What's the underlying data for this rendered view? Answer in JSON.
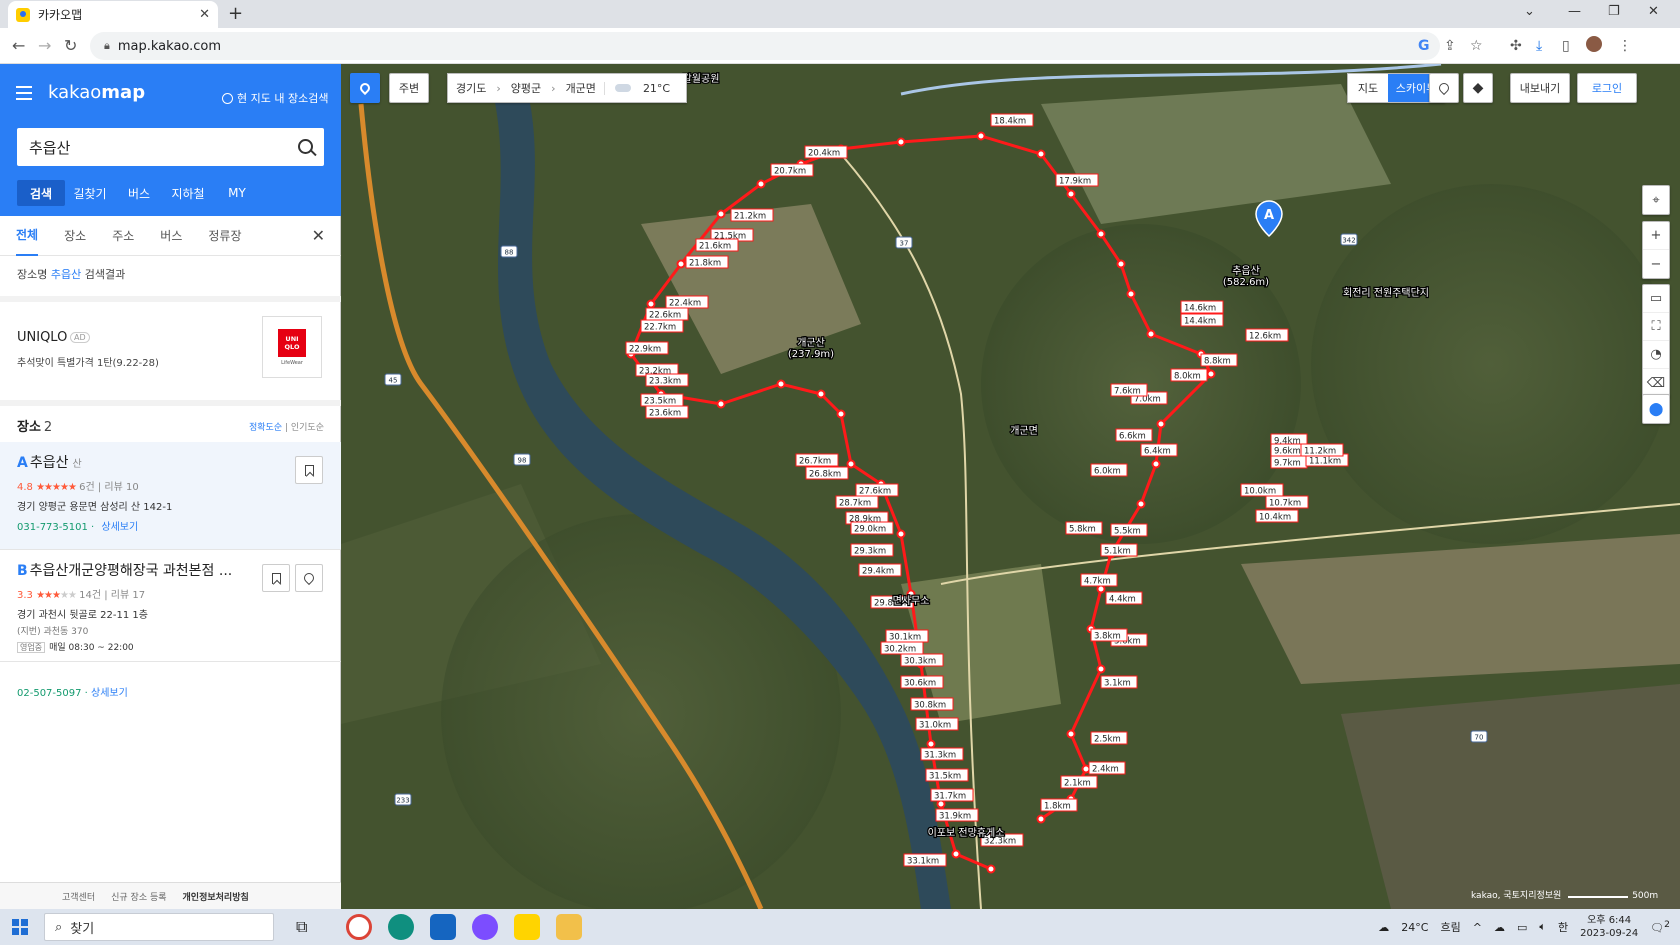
{
  "browser": {
    "tab_title": "카카오맵",
    "url": "map.kakao.com",
    "new_tab": "+",
    "close_tab": "✕"
  },
  "sidebar": {
    "brand_light": "kakao",
    "brand_bold": "map",
    "current_map_search": "현 지도 내 장소검색",
    "search_value": "추읍산",
    "main_tabs": [
      {
        "label": "검색",
        "active": true
      },
      {
        "label": "길찾기"
      },
      {
        "label": "버스"
      },
      {
        "label": "지하철"
      },
      {
        "label": "MY"
      }
    ],
    "sub_tabs": [
      {
        "label": "전체",
        "active": true
      },
      {
        "label": "장소"
      },
      {
        "label": "주소"
      },
      {
        "label": "버스"
      },
      {
        "label": "정류장"
      }
    ],
    "result_caption_prefix": "장소명",
    "result_caption_keyword": "추읍산",
    "result_caption_suffix": "검색결과",
    "ad": {
      "brand": "UNIQLO",
      "badge": "AD",
      "description": "추석맞이 특별가격 1탄(9.22-28)",
      "logo_text": "UNI QLO",
      "logo_sub": "LifeWear"
    },
    "places_label": "장소",
    "places_count": "2",
    "sort_accuracy": "정확도순",
    "sort_popularity": "인기도순",
    "places": [
      {
        "letter": "A",
        "name": "추읍산",
        "category": "산",
        "score": "4.8",
        "reviews_count": "6건",
        "reviews": "리뷰 10",
        "address": "경기 양평군 용문면 삼성리 산 142-1",
        "phone": "031-773-5101",
        "detail_link": "상세보기"
      },
      {
        "letter": "B",
        "name_highlight": "추읍산",
        "name_rest": "개군양평해장국 과천본점 ...",
        "score": "3.3",
        "reviews_count": "14건",
        "reviews": "리뷰 17",
        "address": "경기 과천시 뒷골로 22-11 1층",
        "lot_address": "(지번) 과천동 370",
        "hours_tag": "영업중",
        "hours": "매일 08:30 ~ 22:00",
        "phone": "02-507-5097",
        "detail_link": "상세보기"
      }
    ],
    "footer": [
      "고객센터",
      "신규 장소 등록",
      "개인정보처리방침"
    ]
  },
  "map": {
    "nearby_button": "주변",
    "breadcrumb": [
      "경기도",
      "양평군",
      "개군면"
    ],
    "temperature": "21°C",
    "map_type_normal": "지도",
    "map_type_skyview": "스카이뷰",
    "export_button": "내보내기",
    "login_button": "로그인",
    "scale_text": "kakao, 국토지리정보원",
    "scale_value": "500m",
    "place_labels": [
      {
        "name": "갈월공원"
      },
      {
        "name": "개군산",
        "sub": "(237.9m)"
      },
      {
        "name": "추읍산",
        "sub": "(582.6m)"
      },
      {
        "name": "개군면"
      },
      {
        "name": "회전리 전원주택단지"
      },
      {
        "name": "면사무소"
      },
      {
        "name": "이포보 전망휴게소"
      }
    ],
    "road_numbers": [
      "88",
      "37",
      "342",
      "45",
      "98",
      "70",
      "233"
    ],
    "marker_letter": "A",
    "route_color": "#ff1a1a",
    "km_labels": [
      "1.8km",
      "2.1km",
      "2.4km",
      "2.5km",
      "3.1km",
      "3.6km",
      "3.8km",
      "4.2km",
      "4.4km",
      "4.7km",
      "5.1km",
      "5.5km",
      "5.8km",
      "6.0km",
      "6.4km",
      "6.6km",
      "7.0km",
      "7.6km",
      "8.0km",
      "8.8km",
      "9.4km",
      "9.6km",
      "9.7km",
      "10.0km",
      "10.4km",
      "10.7km",
      "11.1km",
      "11.2km",
      "12.6km",
      "14.4km",
      "14.6km",
      "17.9km",
      "18.4km",
      "20.4km",
      "20.7km",
      "21.2km",
      "21.5km",
      "21.6km",
      "21.8km",
      "22.4km",
      "22.6km",
      "22.7km",
      "22.9km",
      "23.2km",
      "23.3km",
      "23.5km",
      "23.6km",
      "26.7km",
      "26.8km",
      "27.6km",
      "28.7km",
      "28.9km",
      "29.0km",
      "29.3km",
      "29.4km",
      "29.8km",
      "30.1km",
      "30.2km",
      "30.3km",
      "30.6km",
      "30.8km",
      "31.0km",
      "31.3km",
      "31.5km",
      "31.7km",
      "31.9km",
      "32.3km",
      "33.1km"
    ]
  },
  "taskbar": {
    "search_placeholder": "찾기",
    "weather_temp": "24°C",
    "weather_desc": "흐림",
    "ime": "한",
    "time": "오후 6:44",
    "date": "2023-09-24",
    "notifications": "2"
  }
}
